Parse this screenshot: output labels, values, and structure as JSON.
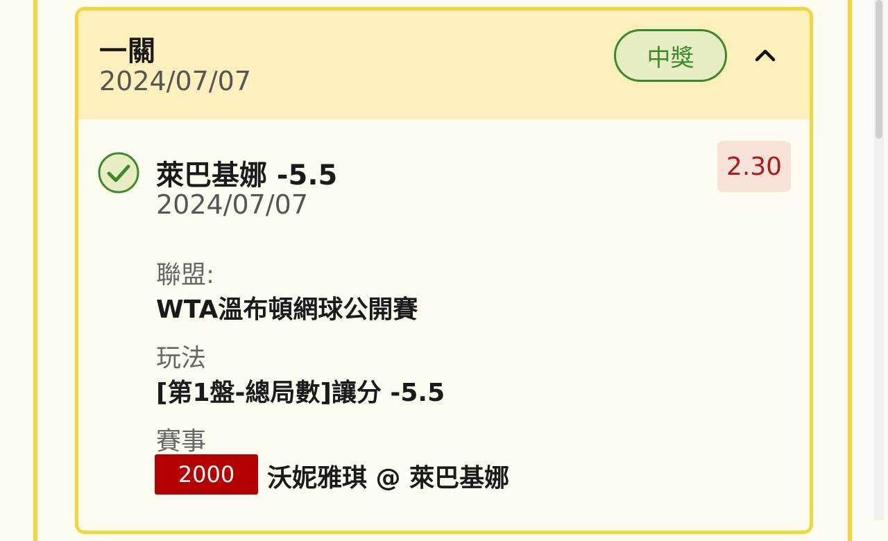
{
  "bet": {
    "type_label": "一關",
    "date": "2024/07/07",
    "status": "中獎",
    "collapse_icon": "chevron-up-icon"
  },
  "selection": {
    "status_icon": "check-circle-icon",
    "title": "萊巴基娜 -5.5",
    "date": "2024/07/07",
    "odds": "2.30"
  },
  "details": {
    "league_label": "聯盟:",
    "league_value": "WTA溫布頓網球公開賽",
    "play_label": "玩法",
    "play_value": "[第1盤-總局數]讓分 -5.5",
    "event_label": "賽事",
    "event_code": "2000",
    "event_name": "沃妮雅琪 @ 萊巴基娜"
  },
  "colors": {
    "card_border": "#f5d63a",
    "header_bg": "#fdf0bd",
    "win_green": "#3a8a2a",
    "odds_red": "#b01818",
    "event_code_bg": "#b30000"
  }
}
